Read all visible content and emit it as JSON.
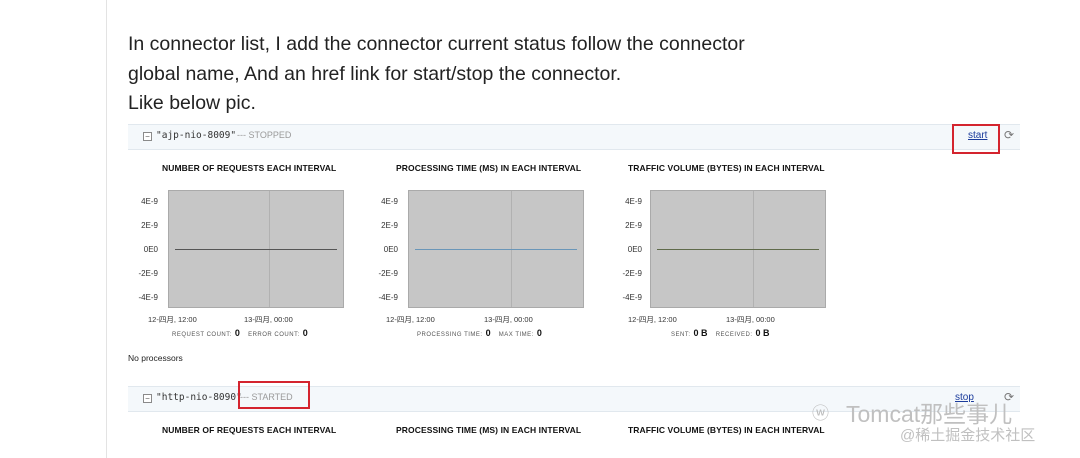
{
  "doc": {
    "para_lines": [
      "In connector list, I add the connector current status follow the connector",
      "global name, And an href link for start/stop the connector.",
      "Like below pic."
    ]
  },
  "connectors": [
    {
      "name": "\"ajp-nio-8009\"",
      "status": "--- STOPPED",
      "action": "start",
      "charts": [
        {
          "title": "NUMBER OF REQUESTS EACH INTERVAL",
          "stats": [
            [
              "REQUEST COUNT:",
              "0"
            ],
            [
              "ERROR COUNT:",
              "0"
            ]
          ],
          "line_color": "#555555"
        },
        {
          "title": "PROCESSING TIME (MS) IN EACH INTERVAL",
          "stats": [
            [
              "PROCESSING TIME:",
              "0"
            ],
            [
              "MAX TIME:",
              "0"
            ]
          ],
          "line_color": "#6a96b8"
        },
        {
          "title": "TRAFFIC VOLUME (BYTES) IN EACH INTERVAL",
          "stats": [
            [
              "SENT:",
              "0 B"
            ],
            [
              "RECEIVED:",
              "0 B"
            ]
          ],
          "line_color": "#5f6a4a"
        }
      ],
      "note": "No processors"
    },
    {
      "name": "\"http-nio-8090\"",
      "status": "--- STARTED",
      "action": "stop",
      "charts": [
        {
          "title": "NUMBER OF REQUESTS EACH INTERVAL"
        },
        {
          "title": "PROCESSING TIME (MS) IN EACH INTERVAL"
        },
        {
          "title": "TRAFFIC VOLUME (BYTES) IN EACH INTERVAL"
        }
      ]
    }
  ],
  "axis": {
    "y_ticks": [
      "4E-9",
      "2E-9",
      "0E0",
      "-2E-9",
      "-4E-9"
    ],
    "x_ticks": [
      "12-四月, 12:00",
      "13-四月, 00:00"
    ]
  },
  "watermark": {
    "icon": "wechat-icon",
    "logo_glyph": "ⓦ",
    "title": "Tomcat那些事儿",
    "sub": "@稀土掘金技术社区"
  }
}
